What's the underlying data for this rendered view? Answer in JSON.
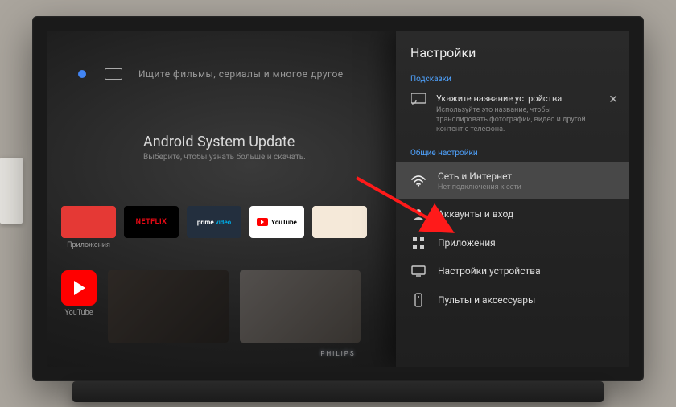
{
  "search": {
    "placeholder": "Ищите фильмы, сериалы и многое другое"
  },
  "update": {
    "title": "Android System Update",
    "subtitle": "Выберите, чтобы узнать больше и скачать."
  },
  "apps": {
    "launcher_label": "Приложения",
    "netflix": "NETFLIX",
    "prime1": "prime",
    "prime2": "video",
    "youtube": "YouTube",
    "yt_label": "YouTube"
  },
  "settings": {
    "panel_title": "Настройки",
    "hints_section": "Подсказки",
    "hint_title": "Укажите название устройства",
    "hint_sub": "Используйте это название, чтобы транслировать фотографии, видео и другой контент с телефона.",
    "general_section": "Общие настройки",
    "network_title": "Сеть и Интернет",
    "network_sub": "Нет подключения к сети",
    "accounts": "Аккаунты и вход",
    "appsrow": "Приложения",
    "device": "Настройки устройства",
    "remotes": "Пульты и аксессуары"
  },
  "brand": "PHILIPS"
}
